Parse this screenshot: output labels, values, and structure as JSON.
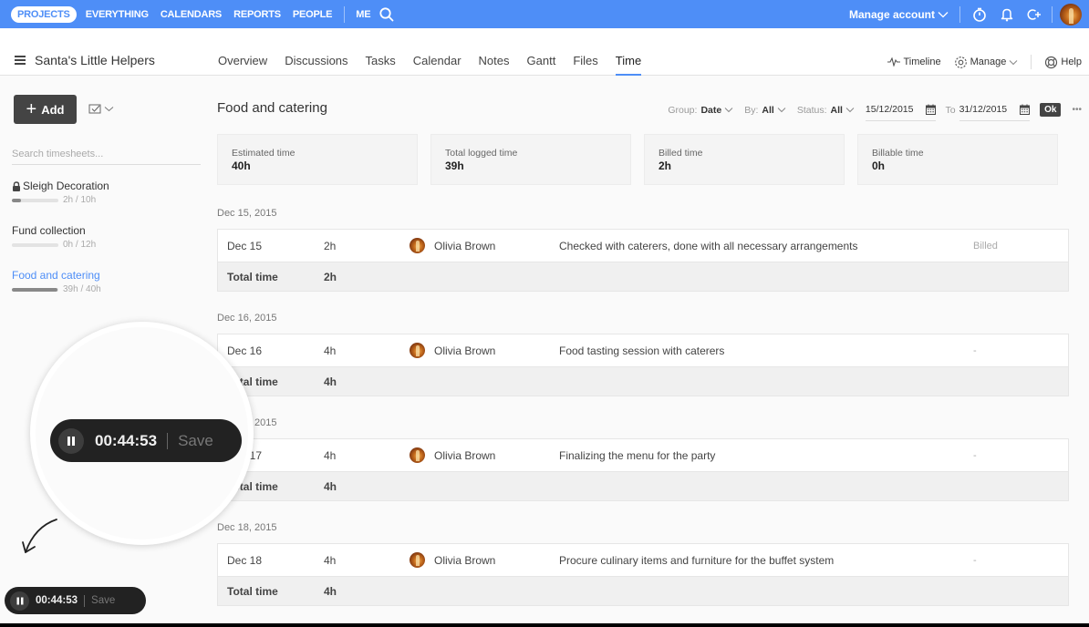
{
  "topnav": {
    "items": [
      {
        "label": "PROJECTS",
        "active": true
      },
      {
        "label": "EVERYTHING"
      },
      {
        "label": "CALENDARS"
      },
      {
        "label": "REPORTS"
      },
      {
        "label": "PEOPLE"
      }
    ],
    "me_label": "ME",
    "manage_account_label": "Manage account",
    "brand_color": "#4e8ef7",
    "icons": [
      "search-icon",
      "stopwatch-icon",
      "bell-icon",
      "invite-icon",
      "avatar"
    ]
  },
  "project": {
    "title": "Santa's Little Helpers",
    "tabs": [
      "Overview",
      "Discussions",
      "Tasks",
      "Calendar",
      "Notes",
      "Gantt",
      "Files",
      "Time"
    ],
    "active_tab": "Time",
    "tools": {
      "timeline": "Timeline",
      "manage": "Manage",
      "help": "Help"
    }
  },
  "sidebar": {
    "add_label": "Add",
    "search_placeholder": "Search timesheets...",
    "timesheets": [
      {
        "name": "Sleigh Decoration",
        "locked": true,
        "logged": "2h",
        "estimated": "10h",
        "progress": 0.2,
        "active": false
      },
      {
        "name": "Fund collection",
        "locked": false,
        "logged": "0h",
        "estimated": "12h",
        "progress": 0.0,
        "active": false
      },
      {
        "name": "Food and catering",
        "locked": false,
        "logged": "39h",
        "estimated": "40h",
        "progress": 0.975,
        "active": true
      }
    ]
  },
  "main": {
    "title": "Food and catering",
    "filters": {
      "group_label": "Group:",
      "group_value": "Date",
      "by_label": "By:",
      "by_value": "All",
      "status_label": "Status:",
      "status_value": "All",
      "from_date": "15/12/2015",
      "to_label": "To",
      "to_date": "31/12/2015",
      "ok_label": "Ok",
      "more_label": "•••"
    },
    "stats": [
      {
        "label": "Estimated time",
        "value": "40h"
      },
      {
        "label": "Total logged time",
        "value": "39h"
      },
      {
        "label": "Billed time",
        "value": "2h"
      },
      {
        "label": "Billable time",
        "value": "0h"
      }
    ],
    "total_label": "Total time",
    "groups": [
      {
        "date": "Dec 15, 2015",
        "entries": [
          {
            "date": "Dec 15",
            "hours": "2h",
            "user": "Olivia Brown",
            "description": "Checked with caterers, done with all necessary arrangements",
            "status": "Billed"
          }
        ],
        "total": "2h"
      },
      {
        "date": "Dec 16, 2015",
        "entries": [
          {
            "date": "Dec 16",
            "hours": "4h",
            "user": "Olivia Brown",
            "description": "Food tasting session with caterers",
            "status": "-"
          }
        ],
        "total": "4h"
      },
      {
        "date": "Dec 17, 2015",
        "entries": [
          {
            "date": "Dec 17",
            "hours": "4h",
            "user": "Olivia Brown",
            "description": "Finalizing the menu for the party",
            "status": "-"
          }
        ],
        "total": "4h"
      },
      {
        "date": "Dec 18, 2015",
        "entries": [
          {
            "date": "Dec 18",
            "hours": "4h",
            "user": "Olivia Brown",
            "description": "Procure culinary items and furniture for the buffet system",
            "status": "-"
          }
        ],
        "total": "4h"
      }
    ]
  },
  "timer": {
    "elapsed": "00:44:53",
    "save_label": "Save"
  }
}
